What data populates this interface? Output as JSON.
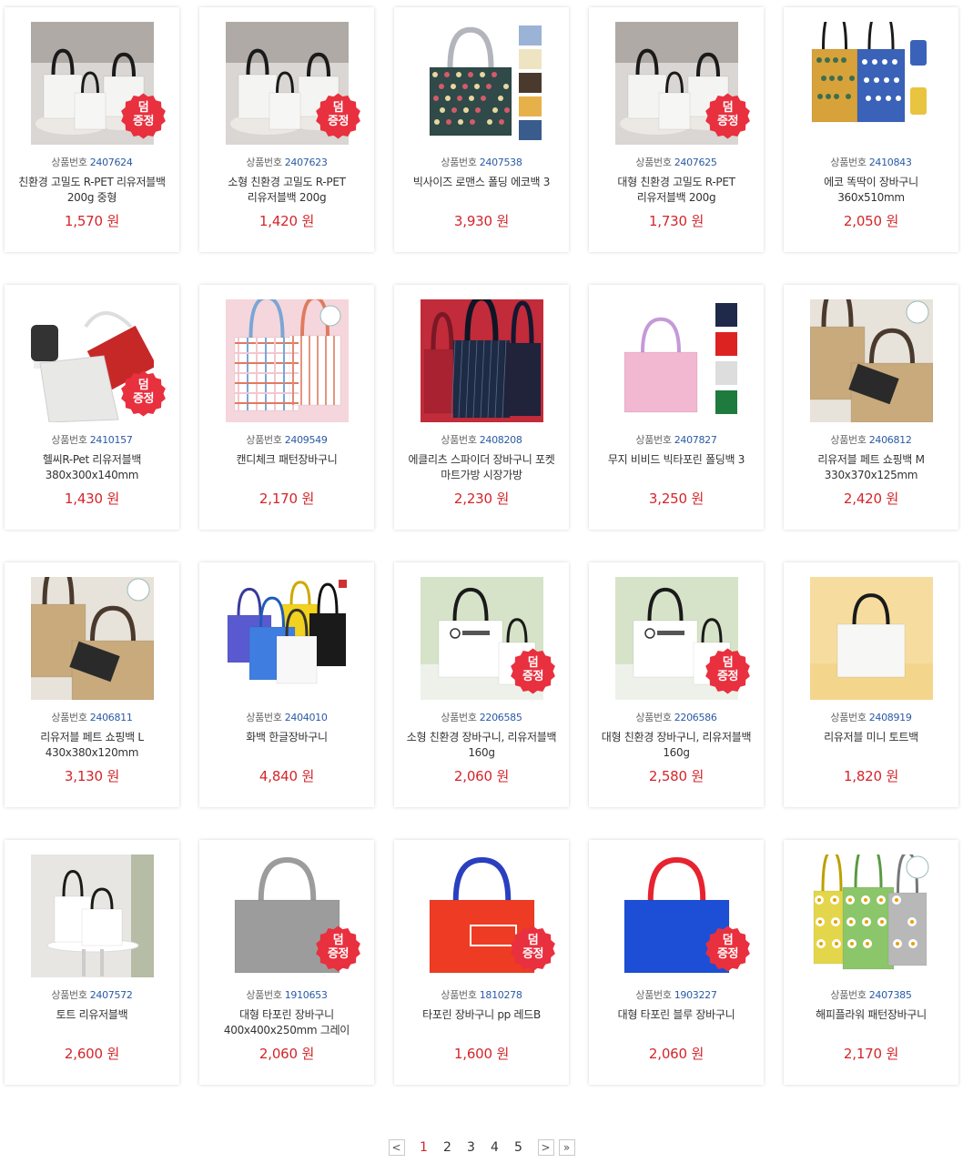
{
  "labels": {
    "code_prefix": "상품번호",
    "currency": "원",
    "badge_line1": "덤",
    "badge_line2": "증정"
  },
  "products": [
    {
      "code": "2407624",
      "name": "친환경 고밀도 R-PET 리유저블백 200g 중형",
      "price": "1,570",
      "badge": true,
      "img": "white-totes",
      "colors": [
        "#d9d6d3",
        "#8e8781",
        "#1a1a1a"
      ]
    },
    {
      "code": "2407623",
      "name": "소형 친환경 고밀도 R-PET 리유저블백 200g",
      "price": "1,420",
      "badge": true,
      "img": "white-totes",
      "colors": [
        "#d9d6d3",
        "#8e8781",
        "#1a1a1a"
      ]
    },
    {
      "code": "2407538",
      "name": "빅사이즈 로맨스 폴딩 에코백 3",
      "price": "3,930",
      "badge": false,
      "img": "pattern-tote",
      "colors": [
        "#2f4a48",
        "#b2b6bc",
        "#d65a6a"
      ]
    },
    {
      "code": "2407625",
      "name": "대형 친환경 고밀도 R-PET 리유저블백 200g",
      "price": "1,730",
      "badge": true,
      "img": "white-totes",
      "colors": [
        "#d9d6d3",
        "#8e8781",
        "#1a1a1a"
      ]
    },
    {
      "code": "2410843",
      "name": "에코 똑딱이 장바구니 360x510mm",
      "price": "2,050",
      "badge": false,
      "img": "fold-pair",
      "colors": [
        "#d8a23a",
        "#3a62b8",
        "#e8c440"
      ]
    },
    {
      "code": "2410157",
      "name": "헬씨R-Pet 리유저블백 380x300x140mm",
      "price": "1,430",
      "badge": true,
      "img": "white-nike",
      "colors": [
        "#e8e8e6",
        "#c62828",
        "#333333"
      ]
    },
    {
      "code": "2409549",
      "name": "캔디체크 패턴장바구니",
      "price": "2,170",
      "badge": false,
      "img": "check-tote",
      "colors": [
        "#f3c7d0",
        "#7aa6d6",
        "#e07a5f"
      ]
    },
    {
      "code": "2408208",
      "name": "에클리츠 스파이더 장바구니 포켓 마트가방 시장가방",
      "price": "2,230",
      "badge": false,
      "img": "dark-totes",
      "colors": [
        "#1d2b45",
        "#c22b3a",
        "#20233a"
      ]
    },
    {
      "code": "2407827",
      "name": "무지 비비드 빅타포린 폴딩백 3",
      "price": "3,250",
      "badge": false,
      "img": "pink-tote",
      "colors": [
        "#f2b7d1",
        "#c49ad9",
        "#1f7a3e"
      ]
    },
    {
      "code": "2406812",
      "name": "리유저블 페트 쇼핑백 M 330x370x125mm",
      "price": "2,420",
      "badge": false,
      "img": "kraft-tote",
      "colors": [
        "#c8aa7d",
        "#4a3a2e",
        "#2a2a2a"
      ]
    },
    {
      "code": "2406811",
      "name": "리유저블 페트 쇼핑백 L 430x380x120mm",
      "price": "3,130",
      "badge": false,
      "img": "kraft-tote",
      "colors": [
        "#c8aa7d",
        "#4a3a2e",
        "#2a2a2a"
      ]
    },
    {
      "code": "2404010",
      "name": "화백 한글장바구니",
      "price": "4,840",
      "badge": false,
      "img": "multi-totes",
      "colors": [
        "#3f7ee0",
        "#f2d21e",
        "#1a1a1a"
      ]
    },
    {
      "code": "2206585",
      "name": "소형 친환경 장바구니, 리유저블백 160g",
      "price": "2,060",
      "badge": true,
      "img": "white-green",
      "colors": [
        "#d6e3c8",
        "#ffffff",
        "#1a1a1a"
      ]
    },
    {
      "code": "2206586",
      "name": "대형 친환경 장바구니, 리유저블백 160g",
      "price": "2,580",
      "badge": true,
      "img": "white-green",
      "colors": [
        "#d6e3c8",
        "#ffffff",
        "#1a1a1a"
      ]
    },
    {
      "code": "2408919",
      "name": "리유저블 미니 토트백",
      "price": "1,820",
      "badge": false,
      "img": "mini-tote",
      "colors": [
        "#f6dc9e",
        "#f7f7f5",
        "#1a1a1a"
      ]
    },
    {
      "code": "2407572",
      "name": "토트 리유저블백",
      "price": "2,600",
      "badge": false,
      "img": "table-totes",
      "colors": [
        "#e8e6e2",
        "#ffffff",
        "#1a1a1a"
      ]
    },
    {
      "code": "1910653",
      "name": "대형 타포린 장바구니 400x400x250mm 그레이",
      "price": "2,060",
      "badge": true,
      "img": "solid-tote",
      "colors": [
        "#9c9c9c",
        "#9c9c9c",
        "#ffffff"
      ]
    },
    {
      "code": "1810278",
      "name": "타포린 장바구니 pp 레드B",
      "price": "1,600",
      "badge": true,
      "img": "solid-tote",
      "colors": [
        "#ee3b23",
        "#2a3fc0",
        "#ffffff"
      ]
    },
    {
      "code": "1903227",
      "name": "대형 타포린 블루 장바구니",
      "price": "2,060",
      "badge": true,
      "img": "solid-tote",
      "colors": [
        "#1c4fd6",
        "#e6232f",
        "#ffffff"
      ]
    },
    {
      "code": "2407385",
      "name": "해피플라워 패턴장바구니",
      "price": "2,170",
      "badge": false,
      "img": "flower-tote",
      "colors": [
        "#e4d64a",
        "#8cc66a",
        "#f2f2f2"
      ]
    }
  ],
  "pagination": {
    "prev_label": "<",
    "next_label": ">",
    "last_label": "»",
    "pages": [
      "1",
      "2",
      "3",
      "4",
      "5"
    ],
    "current": "1"
  }
}
